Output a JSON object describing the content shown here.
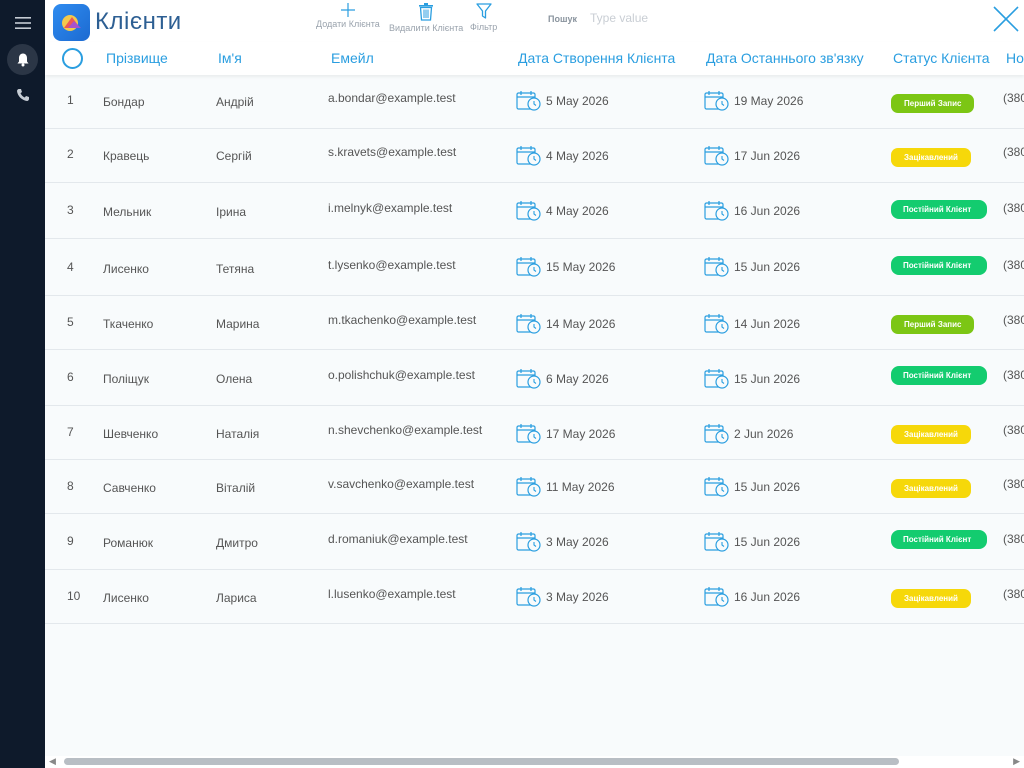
{
  "app": {
    "title": "Клієнти"
  },
  "toolbar": {
    "add_label": "Додати Клієнта",
    "delete_label": "Видалити Клієнта",
    "filter_label": "Фільтр"
  },
  "search": {
    "label": "Пошук",
    "placeholder": "Type value",
    "value": ""
  },
  "columns": {
    "surname": "Прізвище",
    "name": "Ім'я",
    "email": "Емейл",
    "created": "Дата Створення Клієнта",
    "last_contact": "Дата Останнього зв'язку",
    "status": "Статус Клієнта",
    "phone": "Но"
  },
  "status_colors": {
    "first": "#7cc614",
    "interested": "#f6d80a",
    "regular": "#13cc6f"
  },
  "rows": [
    {
      "idx": "1",
      "surname": "Бондар",
      "name": "Андрій",
      "email": "a.bondar@example.test",
      "created": "5 May 2026",
      "last_contact": "19 May 2026",
      "status": "Перший Запис",
      "status_type": "first",
      "phone": "(380"
    },
    {
      "idx": "2",
      "surname": "Кравець",
      "name": "Сергій",
      "email": "s.kravets@example.test",
      "created": "4 May 2026",
      "last_contact": "17 Jun 2026",
      "status": "Зацікавлений",
      "status_type": "interested",
      "phone": "(380"
    },
    {
      "idx": "3",
      "surname": "Мельник",
      "name": "Ірина",
      "email": "i.melnyk@example.test",
      "created": "4 May 2026",
      "last_contact": "16 Jun 2026",
      "status": "Постійний Клієнт",
      "status_type": "regular",
      "phone": "(380"
    },
    {
      "idx": "4",
      "surname": "Лисенко",
      "name": "Тетяна",
      "email": "t.lysenko@example.test",
      "created": "15 May 2026",
      "last_contact": "15 Jun 2026",
      "status": "Постійний Клієнт",
      "status_type": "regular",
      "phone": "(380"
    },
    {
      "idx": "5",
      "surname": "Ткаченко",
      "name": "Марина",
      "email": "m.tkachenko@example.test",
      "created": "14 May 2026",
      "last_contact": "14 Jun 2026",
      "status": "Перший Запис",
      "status_type": "first",
      "phone": "(380"
    },
    {
      "idx": "6",
      "surname": "Поліщук",
      "name": "Олена",
      "email": "o.polishchuk@example.test",
      "created": "6 May 2026",
      "last_contact": "15 Jun 2026",
      "status": "Постійний Клієнт",
      "status_type": "regular",
      "phone": "(380"
    },
    {
      "idx": "7",
      "surname": "Шевченко",
      "name": "Наталія",
      "email": "n.shevchenko@example.test",
      "created": "17 May 2026",
      "last_contact": "2 Jun 2026",
      "status": "Зацікавлений",
      "status_type": "interested",
      "phone": "(380"
    },
    {
      "idx": "8",
      "surname": "Савченко",
      "name": "Віталій",
      "email": "v.savchenko@example.test",
      "created": "11 May 2026",
      "last_contact": "15 Jun 2026",
      "status": "Зацікавлений",
      "status_type": "interested",
      "phone": "(380"
    },
    {
      "idx": "9",
      "surname": "Романюк",
      "name": "Дмитро",
      "email": "d.romaniuk@example.test",
      "created": "3 May 2026",
      "last_contact": "15 Jun 2026",
      "status": "Постійний Клієнт",
      "status_type": "regular",
      "phone": "(380"
    },
    {
      "idx": "10",
      "surname": "Лисенко",
      "name": "Лариса",
      "email": "l.lusenko@example.test",
      "created": "3 May 2026",
      "last_contact": "16 Jun 2026",
      "status": "Зацікавлений",
      "status_type": "interested",
      "phone": "(380"
    }
  ]
}
